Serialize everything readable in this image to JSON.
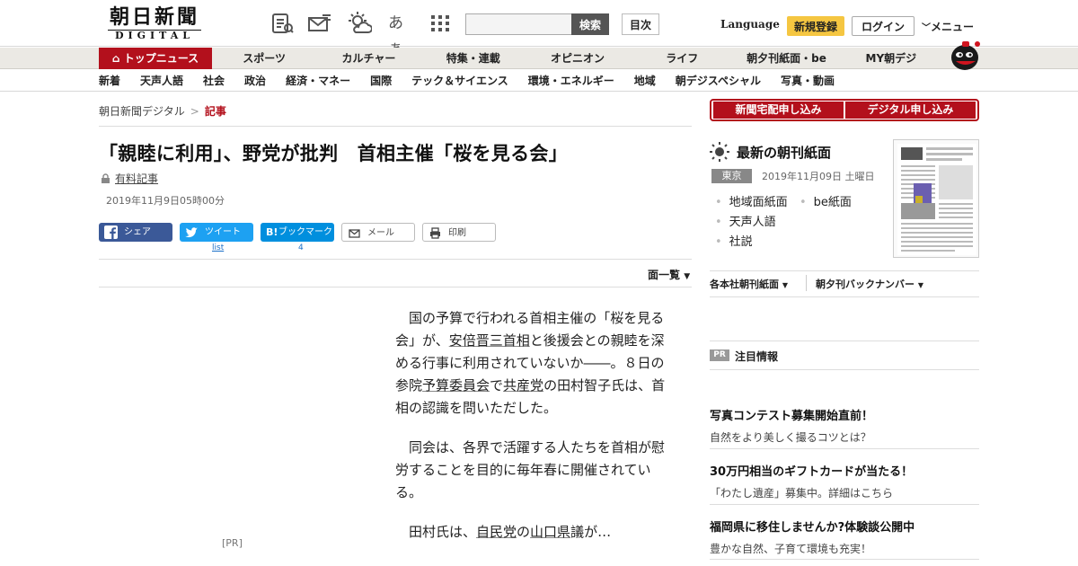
{
  "header": {
    "logo_jp": "朝日新聞",
    "logo_en": "DIGITAL",
    "aa_icon_text": "あぁ",
    "search_button": "検索",
    "index_button": "目次",
    "language": "Language",
    "register": "新規登録",
    "login": "ログイン",
    "menu": "メニュー"
  },
  "main_nav": [
    "トップニュース",
    "スポーツ",
    "カルチャー",
    "特集・連載",
    "オピニオン",
    "ライフ",
    "朝夕刊紙面・be",
    "MY朝デジ"
  ],
  "sub_nav": [
    "新着",
    "天声人語",
    "社会",
    "政治",
    "経済・マネー",
    "国際",
    "テック＆サイエンス",
    "環境・エネルギー",
    "地域",
    "朝デジスペシャル",
    "写真・動画"
  ],
  "breadcrumb": {
    "home": "朝日新聞デジタル",
    "sep": ">",
    "current": "記事"
  },
  "article": {
    "title": "「親睦に利用」、野党が批判　首相主催「桜を見る会」",
    "paid_label": "有料記事",
    "date": "2019年11月9日05時00分",
    "page_list": "面一覧",
    "pr": "[PR]",
    "p1": {
      "t1": "国の予算で行われる首相主催の「桜を見る会」が、",
      "k1": "安倍晋三首相",
      "t2": "と後援会との親睦を深める行事に利用されていないか――。８日の参院",
      "k2": "予算委員会",
      "t3": "で",
      "k3": "共産党",
      "t4": "の田村智子氏は、首相の認識を問いただした。"
    },
    "p2": "同会は、各界で活躍する人たちを首相が慰労することを目的に毎年春に開催されている。",
    "p3": {
      "t1": "田村氏は、",
      "k1": "自民党",
      "t2": "の",
      "k2": "山口県",
      "t3": "議が…"
    }
  },
  "share": {
    "facebook": "シェア",
    "twitter": "ツイート",
    "twitter_count": "list",
    "hatena": "ブックマーク",
    "hatena_count": "4",
    "mail": "メール",
    "print": "印刷"
  },
  "sidebar": {
    "subscribe_home": "新聞宅配申し込み",
    "subscribe_digital": "デジタル申し込み",
    "paper_heading": "最新の朝刊紙面",
    "region": "東京",
    "paper_date": "2019年11月09日 土曜日",
    "paper_links": [
      "地域面紙面",
      "be紙面",
      "天声人語",
      "社説"
    ],
    "dropdown_1": "各本社朝刊紙面",
    "dropdown_2": "朝夕刊バックナンバー",
    "pr_badge": "PR",
    "pr_heading": "注目情報",
    "ads": [
      {
        "title": "写真コンテスト募集開始直前！",
        "sub": "自然をより美しく撮るコツとは？"
      },
      {
        "title": "30万円相当のギフトカードが当たる！",
        "sub": "「わたし遺産」募集中。詳細はこちら"
      },
      {
        "title": "福岡県に移住しませんか?体験談公開中",
        "sub": "豊かな自然、子育て環境も充実！"
      }
    ]
  },
  "colors": {
    "brand_red": "#b3101c",
    "register_yellow": "#f5c641",
    "facebook": "#3b5998",
    "twitter": "#1da1f2",
    "hatena": "#008fde"
  }
}
